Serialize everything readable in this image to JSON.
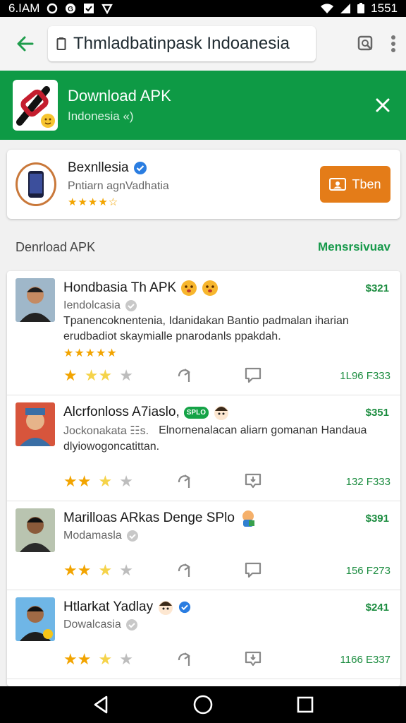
{
  "status": {
    "time_left": "6.IAM",
    "time_right": "1551"
  },
  "toolbar": {
    "url": "Thmladbatinpask Indoanesia"
  },
  "banner": {
    "title": "Download APK",
    "subtitle": "Indonesia «)"
  },
  "featured": {
    "title": "Bexnllesia",
    "subtitle": "Pntiarn agnVadhatia",
    "stars": "★★★★☆",
    "button": "Tben"
  },
  "section": {
    "heading": "Denrload APK",
    "link": "Mensrsivuav"
  },
  "items": [
    {
      "name": "Hondbasia Th APK",
      "sub": "Iendolcasia",
      "desc": "Tpanencoknentenia, Idanidakan Bantio padmalan iharian erudbadiot skaymialle pnarodanls ppakdah.",
      "stars": "★★★★★",
      "price": "$321",
      "count": "1L96 F333"
    },
    {
      "name": "Alcrfonloss A7iaslo,",
      "badge": "SPLO",
      "sub": "Jockonakata ☷s.",
      "desc_inline": "Elnornenalacan aliarn gomanan Handaua",
      "desc": "dlyiowogoncatittan.",
      "price": "$351",
      "count": "132 F333"
    },
    {
      "name": "Marilloas ARkas Denge SPlo",
      "sub": "Modamasla",
      "price": "$391",
      "count": "156 F273"
    },
    {
      "name": "Htlarkat Yadlay",
      "sub": "Dowalcasia",
      "price": "$241",
      "count": "1166 E337"
    }
  ],
  "colors": {
    "accent": "#0e9a45",
    "button": "#e47c18",
    "price": "#1b8c3f",
    "star": "#f2a400"
  }
}
